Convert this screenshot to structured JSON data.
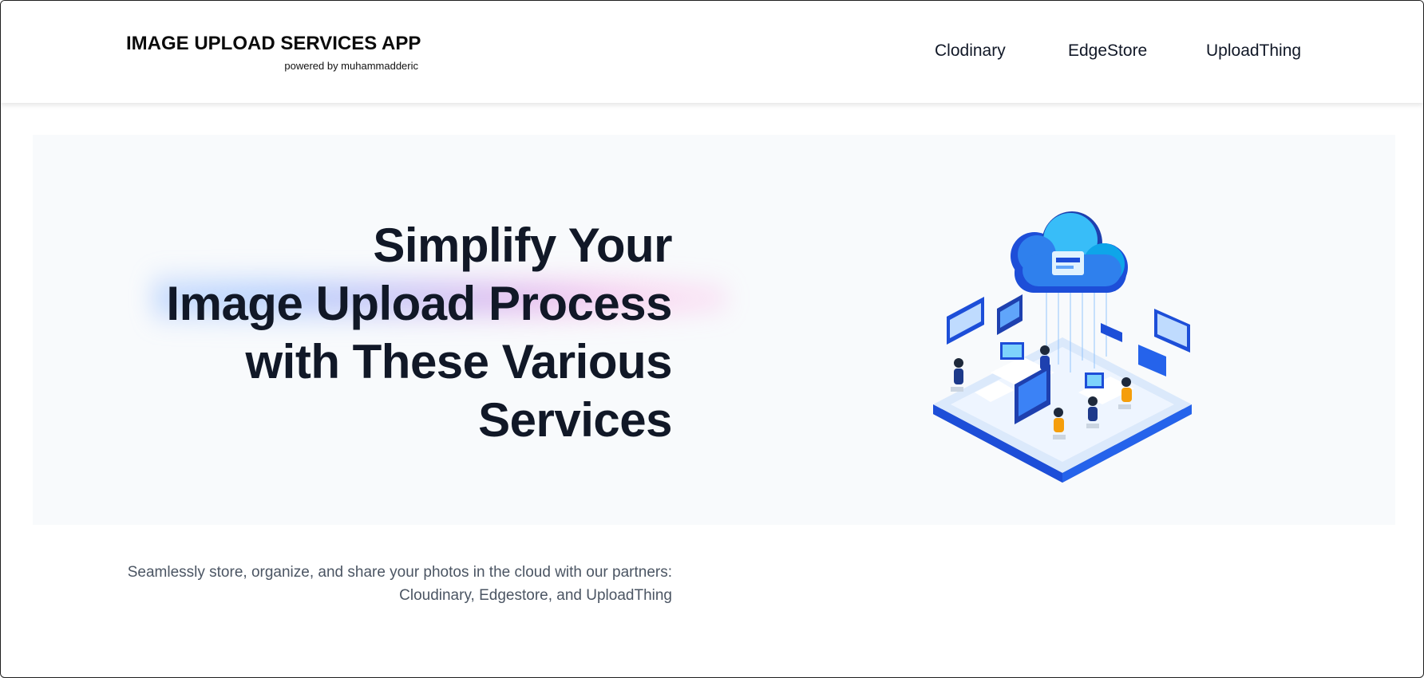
{
  "navbar": {
    "brand_title": "IMAGE UPLOAD SERVICES APP",
    "brand_subtitle": "powered by muhammadderic",
    "links": [
      {
        "label": "Clodinary"
      },
      {
        "label": "EdgeStore"
      },
      {
        "label": "UploadThing"
      }
    ]
  },
  "hero": {
    "headline_lines": [
      "Simplify Your",
      "Image Upload Process",
      "with These Various",
      "Services"
    ],
    "description_lines": [
      "Seamlessly store, organize, and share your photos in the cloud with our partners:",
      "Cloudinary, Edgestore, and UploadThing"
    ],
    "illustration": "isometric-cloud-office-illustration"
  },
  "colors": {
    "headline": "#111827",
    "body_text": "#4b5563",
    "hero_bg": "#f8fafc",
    "illustration_blue": "#1d4ed8",
    "illustration_cyan": "#38bdf8",
    "illustration_orange": "#f59e0b"
  }
}
